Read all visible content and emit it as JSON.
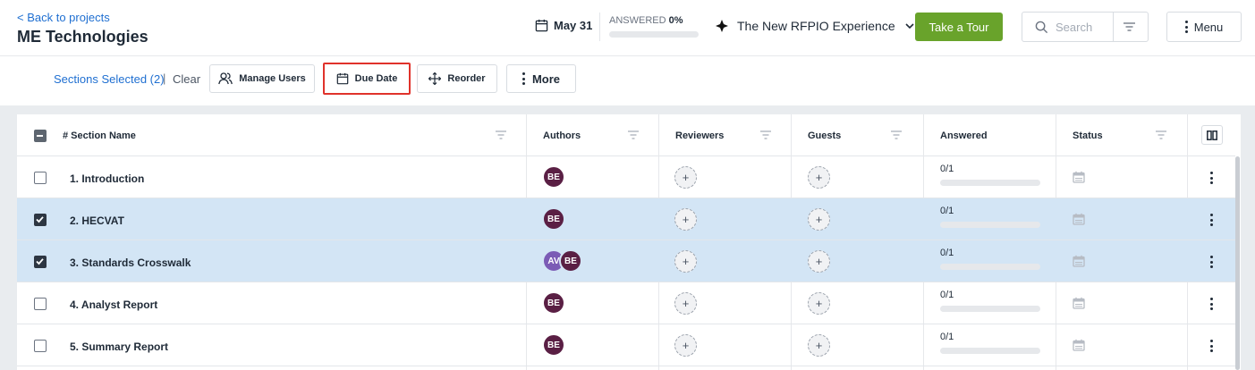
{
  "header": {
    "back_label": "< Back to projects",
    "project_title": "ME Technologies",
    "due_date": "May 31",
    "answered_label": "ANSWERED",
    "answered_pct": "0%",
    "answered_fraction": 0,
    "experience_label": "The New RFPIO Experience",
    "tour_button": "Take a Tour",
    "search_placeholder": "Search",
    "menu_label": "Menu"
  },
  "toolbar": {
    "selected_text": "Sections Selected (2)",
    "separator": "|",
    "clear_label": "Clear",
    "manage_users": "Manage Users",
    "due_date": "Due Date",
    "reorder": "Reorder",
    "more": "More"
  },
  "table": {
    "columns": {
      "section_name": "# Section Name",
      "authors": "Authors",
      "reviewers": "Reviewers",
      "guests": "Guests",
      "answered": "Answered",
      "status": "Status"
    },
    "rows": [
      {
        "name": "1. Introduction",
        "selected": false,
        "authors": [
          "BE"
        ],
        "reviewers_add": "+",
        "guests_add": "+",
        "answered": "0/1",
        "answered_fraction": 0
      },
      {
        "name": "2. HECVAT",
        "selected": true,
        "authors": [
          "BE"
        ],
        "reviewers_add": "+",
        "guests_add": "+",
        "answered": "0/1",
        "answered_fraction": 0
      },
      {
        "name": "3. Standards Crosswalk",
        "selected": true,
        "authors": [
          "AV",
          "BE"
        ],
        "reviewers_add": "+",
        "guests_add": "+",
        "answered": "0/1",
        "answered_fraction": 0
      },
      {
        "name": "4. Analyst Report",
        "selected": false,
        "authors": [
          "BE"
        ],
        "reviewers_add": "+",
        "guests_add": "+",
        "answered": "0/1",
        "answered_fraction": 0
      },
      {
        "name": "5. Summary Report",
        "selected": false,
        "authors": [
          "BE"
        ],
        "reviewers_add": "+",
        "guests_add": "+",
        "answered": "0/1",
        "answered_fraction": 0
      }
    ]
  },
  "colors": {
    "accent_green": "#69a32b",
    "link_blue": "#1f6fd1",
    "selected_row": "#d3e5f5",
    "highlight_red": "#e0322b",
    "avatar_be": "#5a1f44",
    "avatar_av": "#7b5bb5"
  },
  "icons": {
    "calendar": "calendar-icon",
    "diamond": "diamond-icon",
    "chevron": "chevron-down-icon",
    "search": "search-icon",
    "filter": "filter-icon",
    "kebab": "kebab-icon",
    "users": "users-icon",
    "move": "move-icon",
    "columns": "columns-icon"
  }
}
